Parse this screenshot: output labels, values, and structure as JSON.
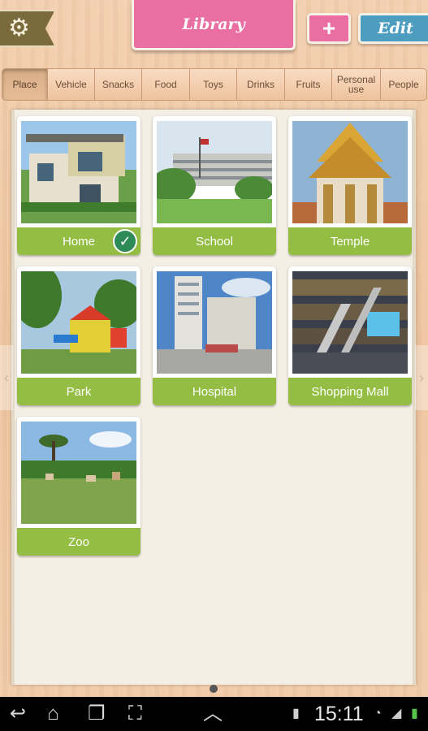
{
  "header": {
    "settings_icon": "gear-icon",
    "library_label": "Library",
    "add_label": "+",
    "edit_label": "Edit"
  },
  "tabs": [
    {
      "label": "Place",
      "active": true
    },
    {
      "label": "Vehicle"
    },
    {
      "label": "Snacks"
    },
    {
      "label": "Food"
    },
    {
      "label": "Toys"
    },
    {
      "label": "Drinks"
    },
    {
      "label": "Fruits"
    },
    {
      "label": "Personal use"
    },
    {
      "label": "People"
    }
  ],
  "cards": [
    {
      "label": "Home",
      "selected": true
    },
    {
      "label": "School"
    },
    {
      "label": "Temple"
    },
    {
      "label": "Park"
    },
    {
      "label": "Hospital"
    },
    {
      "label": "Shopping Mall"
    },
    {
      "label": "Zoo"
    }
  ],
  "statusbar": {
    "time": "15:11",
    "icons": [
      "back-icon",
      "home-icon",
      "recent-apps-icon",
      "screenshot-icon",
      "up-icon",
      "sd-card-icon",
      "wifi-icon",
      "signal-icon",
      "battery-icon"
    ]
  },
  "colors": {
    "pink": "#e96fa3",
    "blue": "#4c9dbf",
    "green": "#93be43",
    "check": "#2e8a57"
  }
}
